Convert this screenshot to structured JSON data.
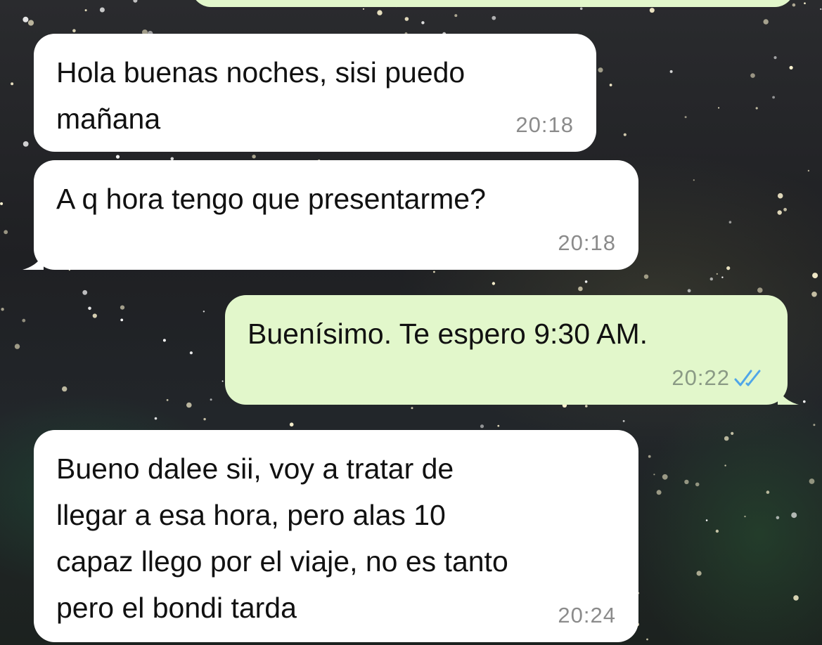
{
  "chat": {
    "messages": [
      {
        "direction": "incoming",
        "text": "Hola buenas noches, sisi puedo\nmañana",
        "time": "20:18"
      },
      {
        "direction": "incoming",
        "text": "A q hora tengo que presentarme?",
        "time": "20:18"
      },
      {
        "direction": "outgoing",
        "text": "Buenísimo. Te espero 9:30 AM.",
        "time": "20:22",
        "status_icon": "double-check-read-icon"
      },
      {
        "direction": "incoming",
        "text": "Bueno dalee sii, voy a tratar de\nllegar a esa hora, pero alas 10\ncapaz llego por el viaje, no es tanto\npero el bondi tarda",
        "time": "20:24"
      }
    ]
  },
  "colors": {
    "incoming_bubble": "#ffffff",
    "outgoing_bubble": "#e2f7cb",
    "timestamp": "#8b8b8b",
    "read_ticks": "#4fa6e8"
  }
}
